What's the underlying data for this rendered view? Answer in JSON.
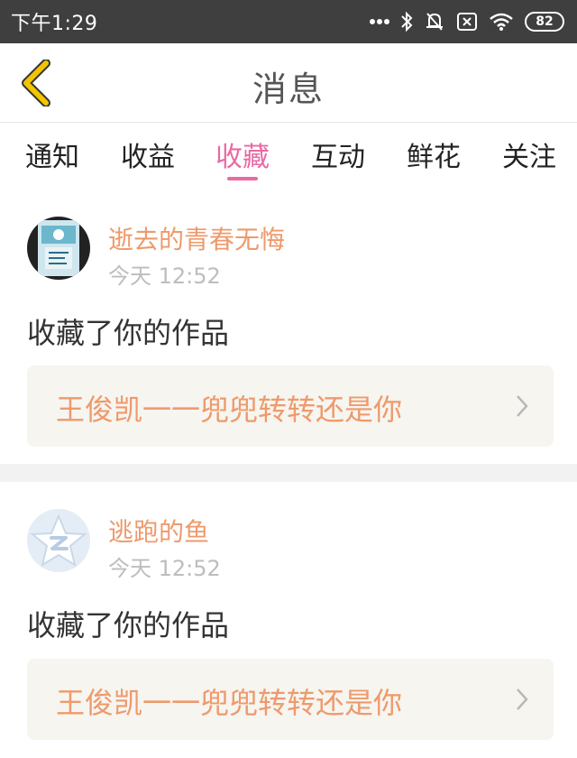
{
  "status_bar": {
    "time": "下午1:29",
    "battery": "82"
  },
  "header": {
    "title": "消息"
  },
  "tabs": [
    {
      "label": "通知"
    },
    {
      "label": "收益"
    },
    {
      "label": "收藏",
      "active": true
    },
    {
      "label": "互动"
    },
    {
      "label": "鲜花"
    },
    {
      "label": "关注"
    }
  ],
  "messages": [
    {
      "user": "逝去的青春无悔",
      "time": "今天 12:52",
      "action": "收藏了你的作品",
      "work_title": "王俊凯一一兜兜转转还是你",
      "avatar_icon": "book-cover-avatar"
    },
    {
      "user": "逃跑的鱼",
      "time": "今天 12:52",
      "action": "收藏了你的作品",
      "work_title": "王俊凯一一兜兜转转还是你",
      "avatar_icon": "default-star-avatar"
    }
  ],
  "colors": {
    "accent": "#e96aa5",
    "name_orange": "#ee9a6c",
    "back_arrow": "#f2c500",
    "status_bar_bg": "#3f3f3f",
    "link_bg": "#f6f5f0"
  }
}
